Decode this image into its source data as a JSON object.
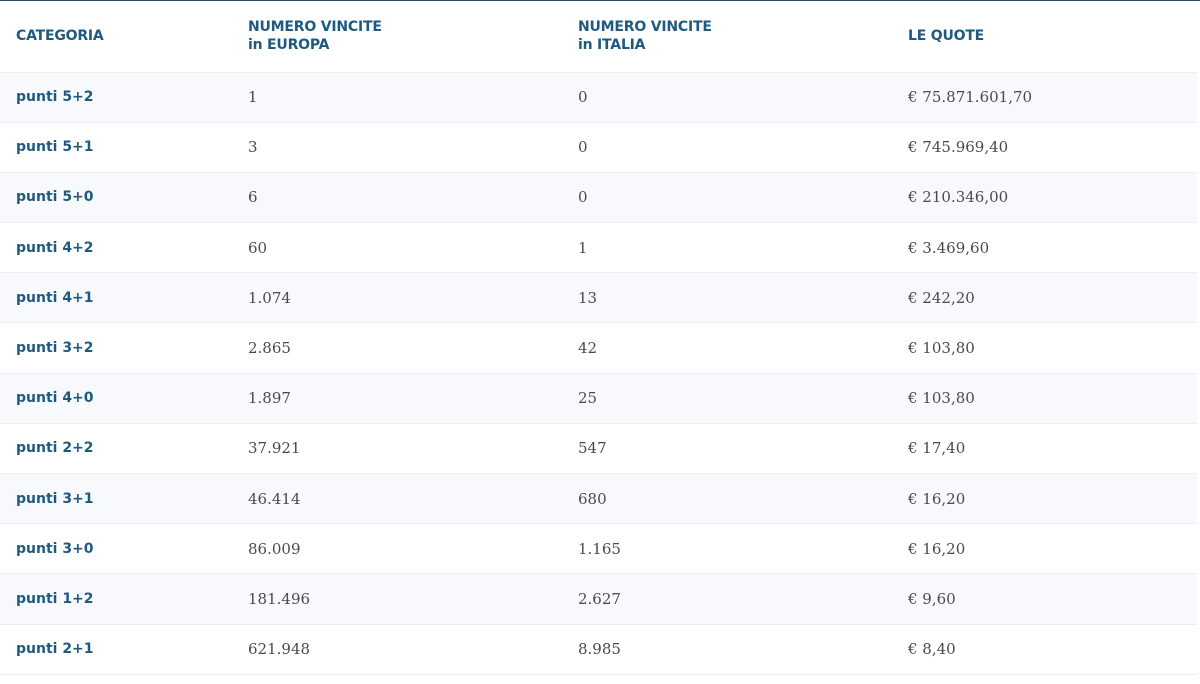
{
  "table": {
    "headers": {
      "categoria": "CATEGORIA",
      "europa_line1": "NUMERO VINCITE",
      "europa_line2": "in EUROPA",
      "italia_line1": "NUMERO VINCITE",
      "italia_line2": "in ITALIA",
      "quote": "LE QUOTE"
    },
    "rows": [
      {
        "categoria": "punti 5+2",
        "europa": "1",
        "italia": "0",
        "quota": "€ 75.871.601,70"
      },
      {
        "categoria": "punti 5+1",
        "europa": "3",
        "italia": "0",
        "quota": "€ 745.969,40"
      },
      {
        "categoria": "punti 5+0",
        "europa": "6",
        "italia": "0",
        "quota": "€ 210.346,00"
      },
      {
        "categoria": "punti 4+2",
        "europa": "60",
        "italia": "1",
        "quota": "€ 3.469,60"
      },
      {
        "categoria": "punti 4+1",
        "europa": "1.074",
        "italia": "13",
        "quota": "€ 242,20"
      },
      {
        "categoria": "punti 3+2",
        "europa": "2.865",
        "italia": "42",
        "quota": "€ 103,80"
      },
      {
        "categoria": "punti 4+0",
        "europa": "1.897",
        "italia": "25",
        "quota": "€ 103,80"
      },
      {
        "categoria": "punti 2+2",
        "europa": "37.921",
        "italia": "547",
        "quota": "€ 17,40"
      },
      {
        "categoria": "punti 3+1",
        "europa": "46.414",
        "italia": "680",
        "quota": "€ 16,20"
      },
      {
        "categoria": "punti 3+0",
        "europa": "86.009",
        "italia": "1.165",
        "quota": "€ 16,20"
      },
      {
        "categoria": "punti 1+2",
        "europa": "181.496",
        "italia": "2.627",
        "quota": "€ 9,60"
      },
      {
        "categoria": "punti 2+1",
        "europa": "621.948",
        "italia": "8.985",
        "quota": "€ 8,40"
      }
    ]
  }
}
